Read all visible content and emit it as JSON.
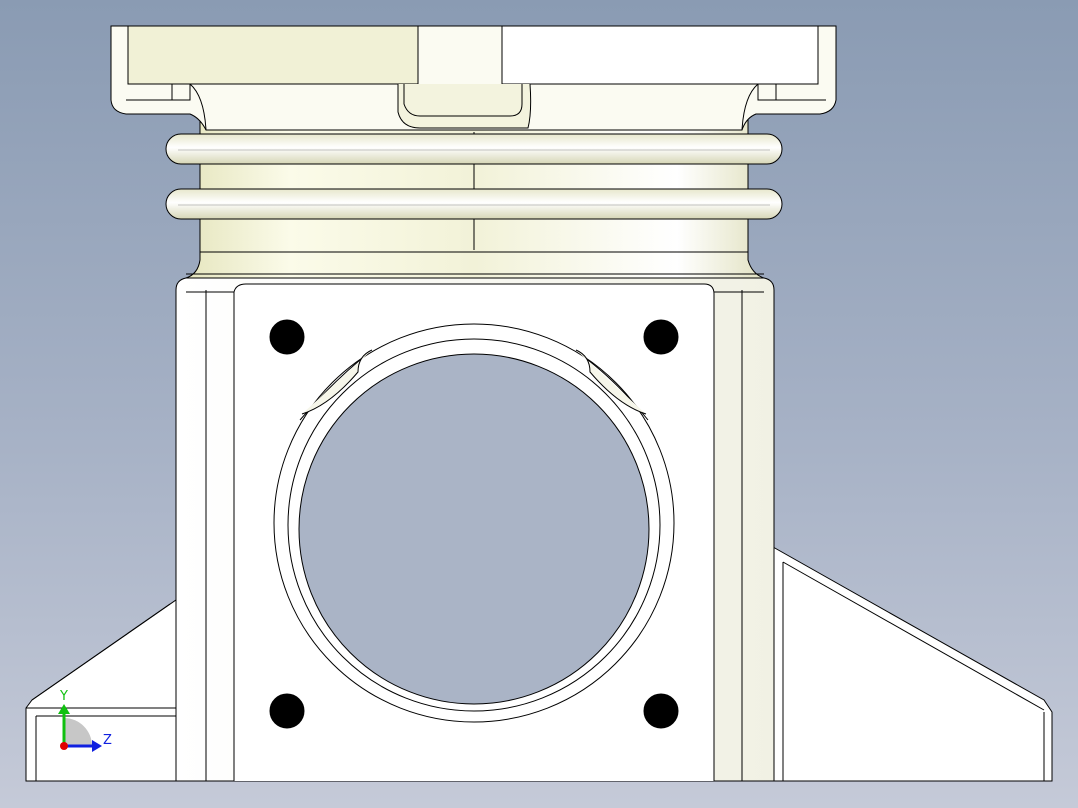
{
  "app": {
    "window_title": ""
  },
  "viewport": {
    "background_top": "#8a9bb3",
    "background_bottom": "#c5cad8",
    "part_color": "#ffffff",
    "part_cream_color": "#f1f1d6",
    "edge_color": "#000000",
    "hole_color": "#000000"
  },
  "triad": {
    "x_axis_label": "",
    "y_axis_label": "Y",
    "z_axis_label": "Z",
    "x_axis_color": "#e00000",
    "y_axis_color": "#10c010",
    "z_axis_color": "#1020e0"
  }
}
